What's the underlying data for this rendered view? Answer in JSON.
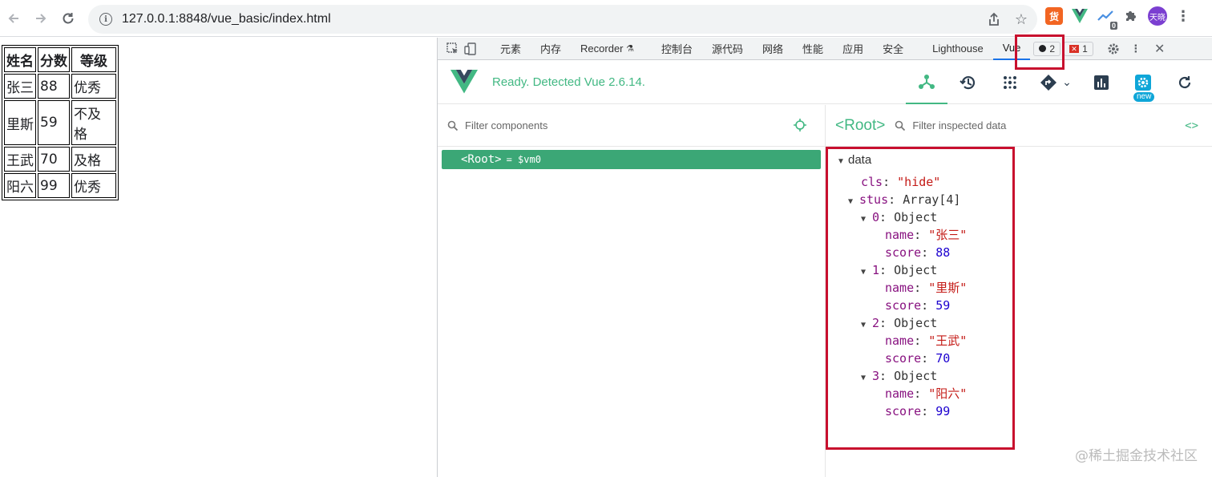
{
  "browser": {
    "url": "127.0.0.1:8848/vue_basic/index.html",
    "extensions": [
      {
        "name": "translate-ext",
        "label": "货",
        "color": "#f26522"
      },
      {
        "name": "vue-devtools-ext",
        "label": "V",
        "color": "#42b883"
      },
      {
        "name": "analytics-ext",
        "label": "0",
        "color": "#4a90e2"
      }
    ],
    "avatar_label": "天晓"
  },
  "table": {
    "headers": [
      "姓名",
      "分数",
      "等级"
    ],
    "rows": [
      [
        "张三",
        "88",
        "优秀"
      ],
      [
        "里斯",
        "59",
        "不及格"
      ],
      [
        "王武",
        "70",
        "及格"
      ],
      [
        "阳六",
        "99",
        "优秀"
      ]
    ]
  },
  "devtools": {
    "tabs": [
      "元素",
      "内存",
      "Recorder",
      "控制台",
      "源代码",
      "网络",
      "性能",
      "应用",
      "安全",
      "Lighthouse",
      "Vue"
    ],
    "active_tab": "Vue",
    "warnings_count": "2",
    "errors_count": "1",
    "vue": {
      "ready_text": "Ready. Detected Vue 2.6.14.",
      "new_badge": "new",
      "filter_components_placeholder": "Filter components",
      "filter_data_placeholder": "Filter inspected data",
      "root_node": "<Root>",
      "root_vm": "= $vm0",
      "inspected_title": "<Root>",
      "code_icon": "<>",
      "data_section": "data",
      "cls_key": "cls",
      "cls_value": "\"hide\"",
      "stus_key": "stus",
      "stus_type": "Array[4]",
      "students": [
        {
          "index": "0",
          "type": "Object",
          "name": "\"张三\"",
          "score": "88"
        },
        {
          "index": "1",
          "type": "Object",
          "name": "\"里斯\"",
          "score": "59"
        },
        {
          "index": "2",
          "type": "Object",
          "name": "\"王武\"",
          "score": "70"
        },
        {
          "index": "3",
          "type": "Object",
          "name": "\"阳六\"",
          "score": "99"
        }
      ],
      "name_key": "name",
      "score_key": "score"
    }
  },
  "watermark": "@稀土掘金技术社区",
  "colors": {
    "vue_green": "#42b883",
    "highlight_red": "#c8102e",
    "root_row_bg": "#3ba776"
  }
}
